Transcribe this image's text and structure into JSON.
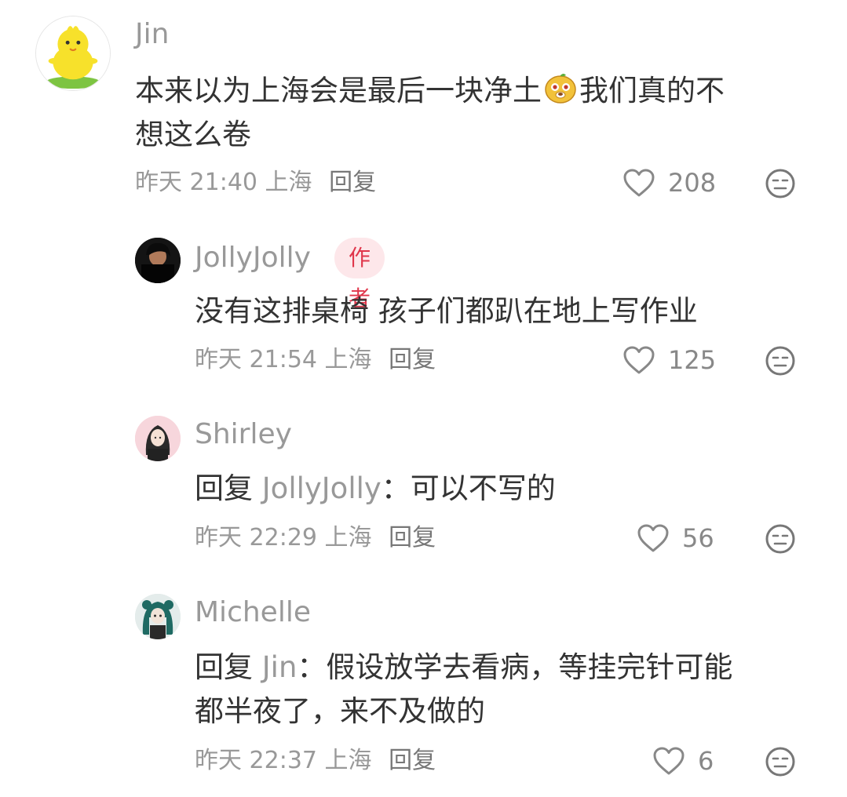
{
  "comments": [
    {
      "username": "Jin",
      "text_before_emoji": "本来以为上海会是最后一块净土",
      "text_after_emoji": "我们真的不",
      "text_line2": "想这么卷",
      "time": "昨天 21:40",
      "location": "上海",
      "reply_label": "回复",
      "likes": "208"
    },
    {
      "username": "JollyJolly",
      "badge": "作者",
      "text": "没有这排桌椅 孩子们都趴在地上写作业",
      "time": "昨天 21:54",
      "location": "上海",
      "reply_label": "回复",
      "likes": "125"
    },
    {
      "username": "Shirley",
      "reply_prefix": "回复",
      "reply_target": "JollyJolly",
      "reply_sep": "：",
      "text": "可以不写的",
      "time": "昨天 22:29",
      "location": "上海",
      "reply_label": "回复",
      "likes": "56"
    },
    {
      "username": "Michelle",
      "reply_prefix": "回复",
      "reply_target": "Jin",
      "reply_sep": "：",
      "text": "假设放学去看病，等挂完针可能",
      "text_line2": "都半夜了，来不及做的",
      "time": "昨天 22:37",
      "location": "上海",
      "reply_label": "回复",
      "likes": "6"
    }
  ],
  "colors": {
    "username": "#999999",
    "body": "#333333",
    "badge_bg": "#fde7ea",
    "badge_text": "#e0364b"
  },
  "icons": {
    "like": "heart-outline-icon",
    "dislike": "meh-face-icon",
    "emoji": "yellow-blob-emoji-icon"
  }
}
